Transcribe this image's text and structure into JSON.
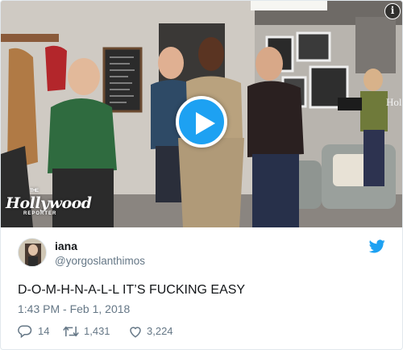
{
  "video": {
    "watermark": {
      "the": "THE",
      "brand": "Hollywood",
      "sub": "REPORTER"
    },
    "background_sign": "Hol",
    "info_label": "i",
    "play_icon": "play-icon"
  },
  "tweet": {
    "display_name": "iana",
    "handle": "@yorgoslanthimos",
    "text": "D-O-M-H-N-A-L-L IT’S FUCKING EASY",
    "timestamp": "1:43 PM - Feb 1, 2018",
    "replies": "14",
    "retweets": "1,431",
    "likes": "3,224"
  },
  "colors": {
    "accent": "#1da1f2",
    "text": "#14171a",
    "muted": "#657786",
    "border": "#e1e8ed"
  },
  "icons": [
    "info-icon",
    "play-icon",
    "twitter-bird-icon",
    "reply-icon",
    "retweet-icon",
    "like-icon"
  ]
}
